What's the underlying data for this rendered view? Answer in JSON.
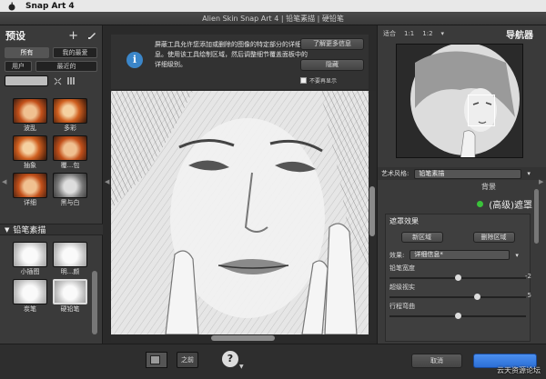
{
  "menubar": {
    "app": "Snap Art 4"
  },
  "window": {
    "title": "Alien Skin Snap Art 4 | 铅笔素描 | 硬铅笔"
  },
  "presets": {
    "title": "预设",
    "filters": [
      "所有",
      "我的最爱"
    ],
    "filters2": [
      "用户",
      "最近的"
    ],
    "thumbs_row1": [
      "波乱",
      "多彩"
    ],
    "thumbs_row2": [
      "抽象",
      "覆...包"
    ],
    "thumbs_row3": [
      "详细",
      "黑与白"
    ],
    "category": "铅笔素描",
    "thumbs_row4": [
      "小插图",
      "明...颜"
    ],
    "thumbs_row5": [
      "炭笔",
      "硬铅笔"
    ]
  },
  "info": {
    "icon": "i",
    "text": "屏蔽工具允许您添加或删除的图像的特定部分的详细信息。使用该工具绘制区域，然后调整细节覆盖面板中的详细级别。",
    "learn_more": "了解更多信息",
    "hide": "隐藏",
    "dont_show": "不要再显示"
  },
  "navigator": {
    "fit": "适合",
    "z1": "1:1",
    "z2": "1:2",
    "title": "导航器"
  },
  "settings": {
    "art_style_label": "艺术风格:",
    "art_style_value": "铅笔素描",
    "background": "背景",
    "advanced_mask": "(高级)遮罩",
    "mask_effects": "遮罩效果",
    "new_region": "新区域",
    "delete_region": "删除区域",
    "effect_label": "效果:",
    "effect_value": "详细信息*",
    "sliders": [
      {
        "label": "铅笔宽度",
        "value": "-2",
        "pos": 0.48
      },
      {
        "label": "超级视实",
        "value": "5",
        "pos": 0.62
      },
      {
        "label": "行程弯曲",
        "value": "",
        "pos": 0.48
      }
    ]
  },
  "bottom": {
    "before": "之前",
    "help": "?",
    "cancel": "取消",
    "watermark": "云天资源论坛"
  }
}
